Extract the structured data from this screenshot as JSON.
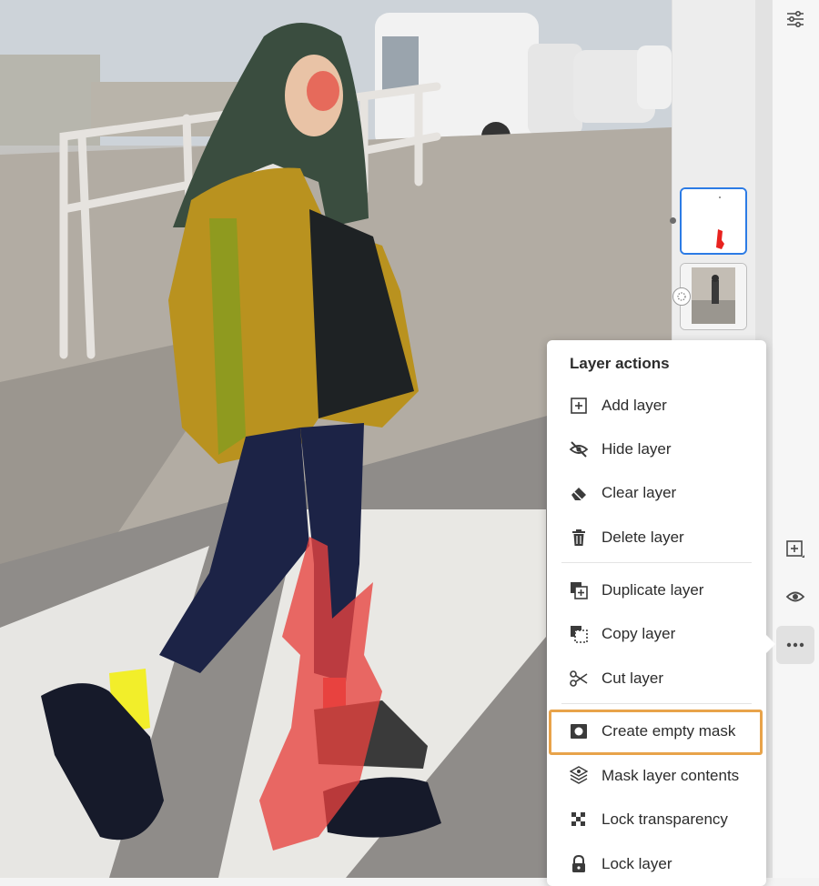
{
  "menu": {
    "title": "Layer actions",
    "items": [
      {
        "label": "Add layer",
        "icon": "plus-square-icon"
      },
      {
        "label": "Hide layer",
        "icon": "eye-slash-icon"
      },
      {
        "label": "Clear layer",
        "icon": "eraser-icon"
      },
      {
        "label": "Delete layer",
        "icon": "trash-icon"
      },
      {
        "label": "Duplicate layer",
        "icon": "duplicate-icon"
      },
      {
        "label": "Copy layer",
        "icon": "copy-icon"
      },
      {
        "label": "Cut layer",
        "icon": "scissors-icon"
      },
      {
        "label": "Create empty mask",
        "icon": "mask-icon"
      },
      {
        "label": "Mask layer contents",
        "icon": "mask-layers-icon"
      },
      {
        "label": "Lock transparency",
        "icon": "checker-icon"
      },
      {
        "label": "Lock layer",
        "icon": "lock-icon"
      }
    ]
  },
  "toolbar": {
    "top_icon": "sliders-icon",
    "add_icon": "add-layer-icon",
    "visibility_icon": "eye-icon",
    "more_icon": "more-dots-icon"
  },
  "layers": [
    {
      "name": "paint-layer",
      "selected": true
    },
    {
      "name": "photo-layer",
      "selected": false
    }
  ],
  "colors": {
    "accent": "#2c7be5",
    "highlight": "#e8a34a",
    "paint_red": "#e8423f"
  }
}
